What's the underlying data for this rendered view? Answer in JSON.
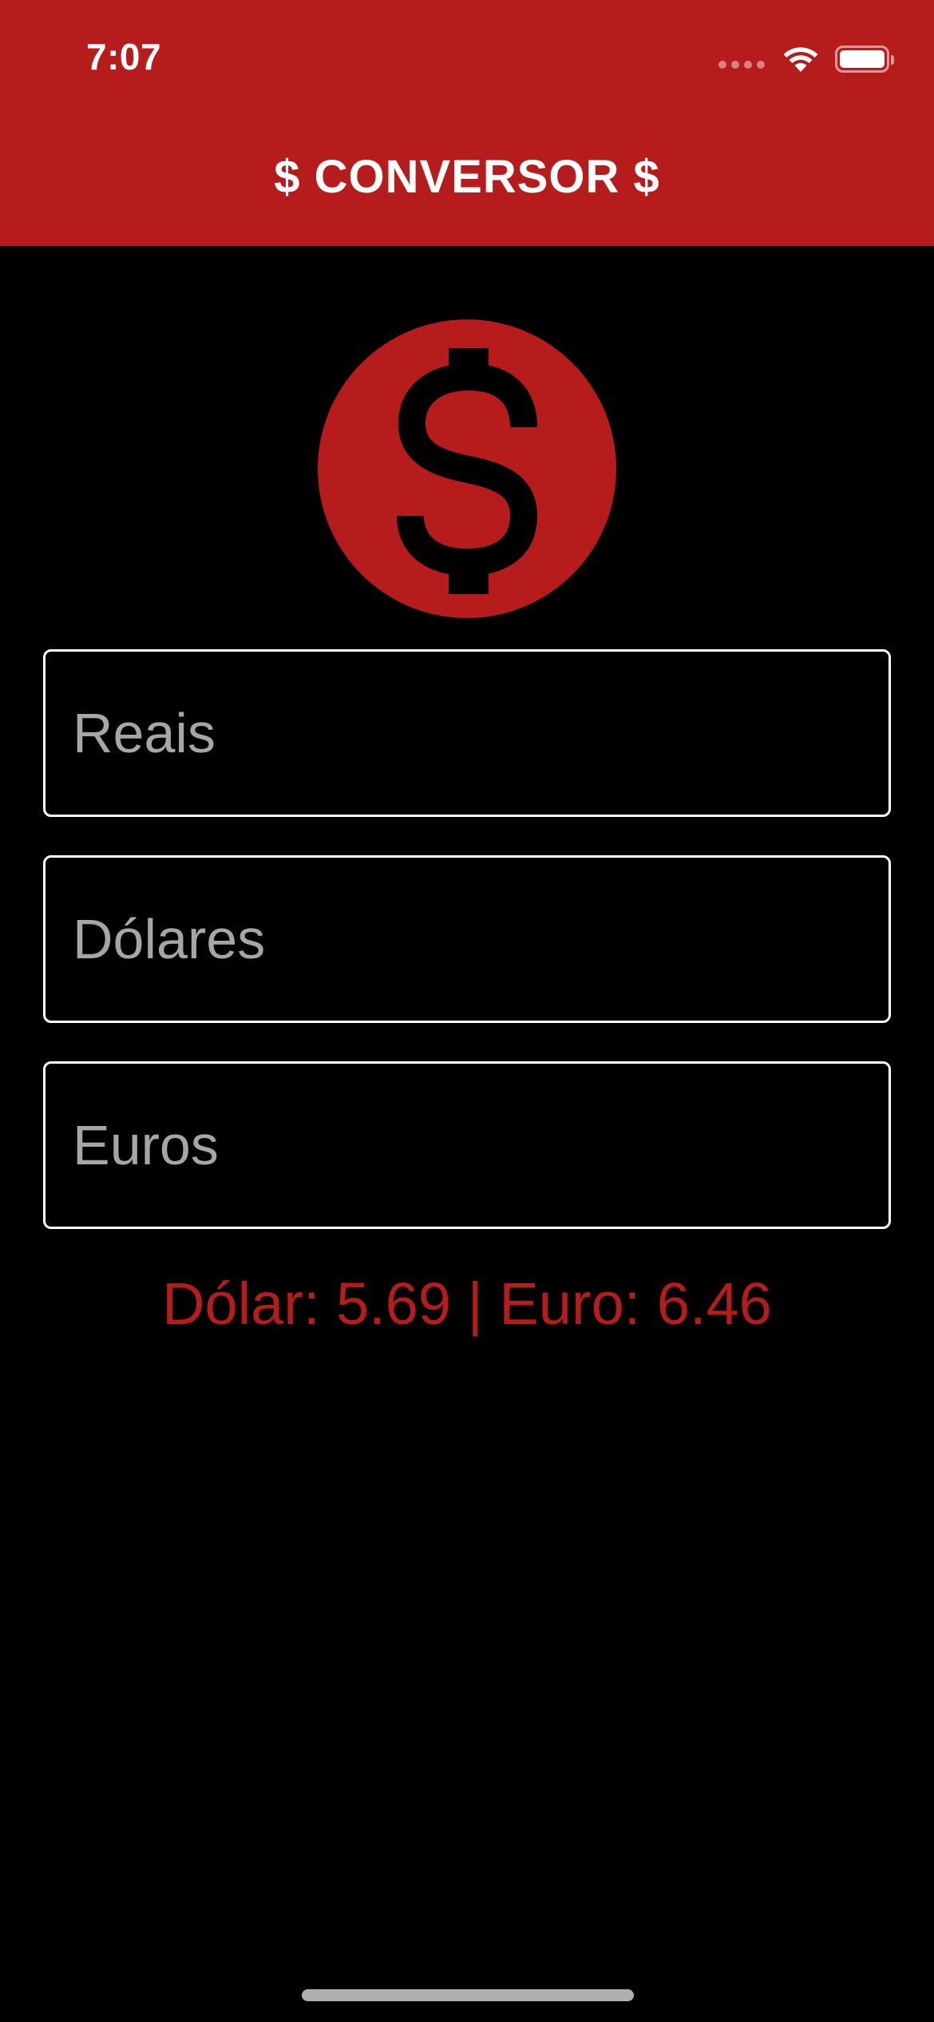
{
  "status_bar": {
    "time": "7:07"
  },
  "app_bar": {
    "title": "$ CONVERSOR $",
    "background_color": "#b71c1c"
  },
  "logo": {
    "icon": "dollar-sign-icon",
    "color": "#b71c1c"
  },
  "fields": {
    "reais": {
      "placeholder": "Reais",
      "value": ""
    },
    "dolares": {
      "placeholder": "Dólares",
      "value": ""
    },
    "euros": {
      "placeholder": "Euros",
      "value": ""
    }
  },
  "rates": {
    "text": "Dólar: 5.69 | Euro: 6.46",
    "color": "#b71c1c"
  },
  "colors": {
    "accent": "#b71c1c",
    "background": "#000000",
    "field_border": "#ffffff",
    "placeholder": "#a6a6a6"
  }
}
